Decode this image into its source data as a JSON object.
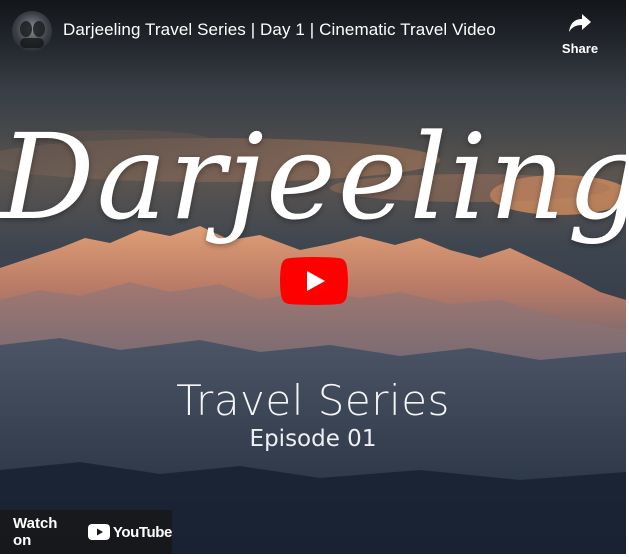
{
  "header": {
    "video_title": "Darjeeling Travel Series | Day 1 | Cinematic Travel Video",
    "share_label": "Share",
    "share_icon": "share-arrow-icon",
    "avatar_icon": "channel-avatar"
  },
  "thumbnail": {
    "title": "Darjeeling",
    "subtitle": "Travel Series",
    "episode": "Episode 01"
  },
  "controls": {
    "play_icon": "play-icon",
    "watch_on_label": "Watch on",
    "youtube_label": "YouTube"
  },
  "colors": {
    "play_red": "#ff0000",
    "sky_dark": "#2b3441",
    "mountain_glow": "#e59a6a"
  }
}
